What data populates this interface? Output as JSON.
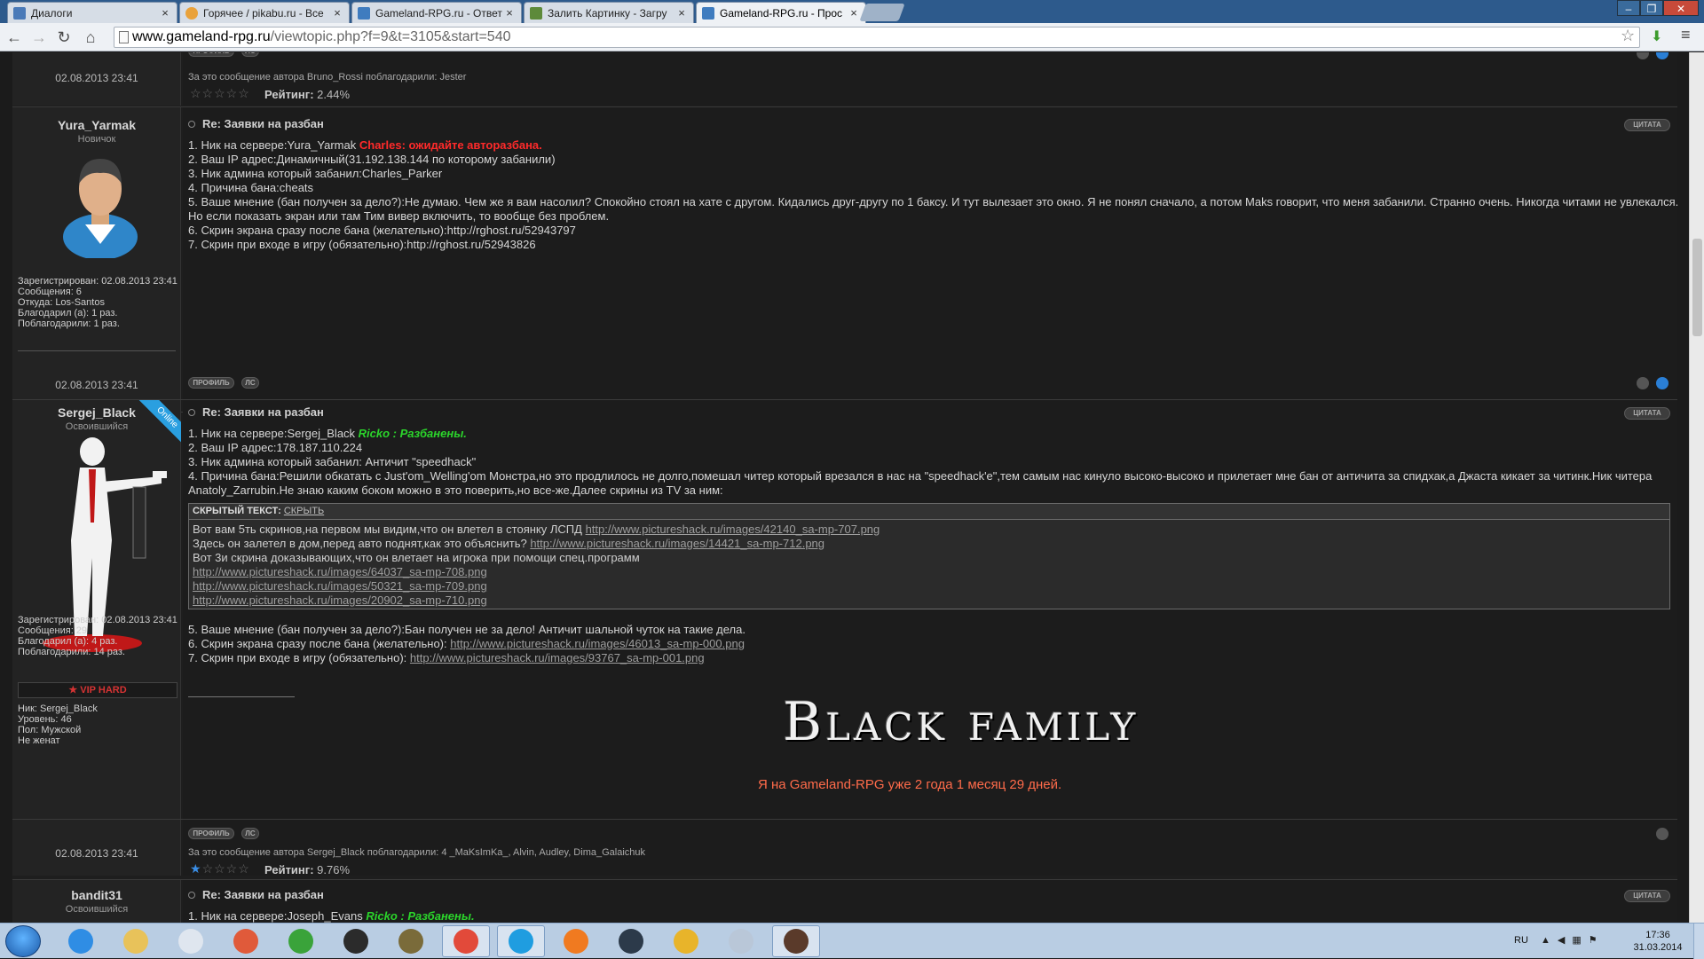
{
  "browser": {
    "tabs": [
      {
        "title": "Диалоги",
        "active": false,
        "color": "#4a7ab8"
      },
      {
        "title": "Горячее / pikabu.ru - Все",
        "active": false,
        "color": "#e9a23b"
      },
      {
        "title": "Gameland-RPG.ru - Ответ",
        "active": false,
        "color": "#3f7cbf"
      },
      {
        "title": "Залить Картинку - Загру",
        "active": false,
        "color": "#5d8a3a"
      },
      {
        "title": "Gameland-RPG.ru - Прос",
        "active": true,
        "color": "#3f7cbf"
      }
    ],
    "url_domain": "www.gameland-rpg.ru",
    "url_path": "/viewtopic.php?f=9&t=3105&start=540",
    "tab_close": "×"
  },
  "forum": {
    "profile_label": "ПРОФИЛЬ",
    "pm_label": "ЛС",
    "quote_label": "ЦИТАТА",
    "top_block": {
      "date": "02.08.2013 23:41",
      "thanks": "За это сообщение автора Bruno_Rossi поблагодарили: Jester",
      "rating_label": "Рейтинг:",
      "rating_value": "2.44%"
    },
    "post1": {
      "username": "Yura_Yarmak",
      "rank": "Новичок",
      "reg": "Зарегистрирован: 02.08.2013 23:41",
      "messages": "Сообщения: 6",
      "from": "Откуда: Los-Santos",
      "thanked": "Благодарил (а): 1 раз.",
      "was_thanked": "Поблагодарили: 1 раз.",
      "title": "Re: Заявки на разбан",
      "line1_pre": "1. Ник на сервере:Yura_Yarmak",
      "line1_red": "Charles: ожидайте авторазбана.",
      "line2": "2. Ваш IP адрес:Динамичный(31.192.138.144 по которому забанили)",
      "line3": "3. Ник админа который забанил:Charles_Parker",
      "line4": "4. Причина бана:cheats",
      "line5": "5. Ваше мнение (бан получен за дело?):Не думаю. Чем же я вам насолил? Спокойно стоял на хате с другом. Кидались друг-другу по 1 баксу. И тут вылезает это окно. Я не понял сначало, а потом Maks говорит, что меня забанили. Странно очень. Никогда читами не увлекался. Но если показать экран или там Тим вивер включить, то вообще без проблем.",
      "line6": "6. Скрин экрана сразу после бана (желательно):http://rghost.ru/52943797",
      "line7": "7. Скрин при входе в игру (обязательно):http://rghost.ru/52943826",
      "date": "02.08.2013 23:41"
    },
    "post2": {
      "username": "Sergej_Black",
      "rank": "Освоившийся",
      "online": "Online",
      "reg": "Зарегистрирован: 02.08.2013 23:41",
      "messages": "Сообщения: 29",
      "thanked": "Благодарил (а): 4 раз.",
      "was_thanked": "Поблагодарили: 14 раз.",
      "vip": "VIP HARD",
      "nick": "Ник: Sergej_Black",
      "level": "Уровень: 46",
      "sex": "Пол: Мужской",
      "married": "Не женат",
      "title": "Re: Заявки на разбан",
      "line1_pre": "1. Ник на сервере:Sergej_Black",
      "line1_grn": "Ricko : Разбанены.",
      "line2": "2. Ваш IP адрес:178.187.110.224",
      "line3": "3. Ник админа который забанил: Античит \"speedhack\"",
      "line4": "4. Причина бана:Решили обкатать с Just'om_Welling'om Монстра,но это продлилось не долго,помешал читер который врезался в нас на \"speedhack'e\",тем самым нас кинуло высоко-высоко и прилетает мне бан от античита за спидхак,а Джаста кикает за читинк.Ник читера Anatoly_Zarrubin.Не знаю каким боком можно в это поверить,но все-же.Далее скрины из TV за ним:",
      "spoiler_label": "СКРЫТЫЙ ТЕКСТ:",
      "spoiler_toggle": "СКРЫТЬ",
      "sp1_text": "Вот вам 5ть скринов,на первом мы видим,что он влетел в стоянку ЛСПД",
      "sp1_link": "http://www.pictureshack.ru/images/42140_sa-mp-707.png",
      "sp2_text": "Здесь он залетел в дом,перед авто поднят,как это объяснить?",
      "sp2_link": "http://www.pictureshack.ru/images/14421_sa-mp-712.png",
      "sp3_text": "Вот 3и скрина доказывающих,что он влетает на игрока при помощи спец.программ",
      "sp4_link": "http://www.pictureshack.ru/images/64037_sa-mp-708.png",
      "sp5_link": "http://www.pictureshack.ru/images/50321_sa-mp-709.png",
      "sp6_link": "http://www.pictureshack.ru/images/20902_sa-mp-710.png",
      "line5": "5. Ваше мнение (бан получен за дело?):Бан получен не за дело! Античит шальной чуток на такие дела.",
      "line6_text": "6. Скрин экрана сразу после бана (желательно):",
      "line6_link": "http://www.pictureshack.ru/images/46013_sa-mp-000.png",
      "line7_text": "7. Скрин при входе в игру (обязательно):",
      "line7_link": "http://www.pictureshack.ru/images/93767_sa-mp-001.png",
      "sig_title": "Black family",
      "sig_sub": "Я на Gameland-RPG уже 2 года 1 месяц 29 дней.",
      "date": "02.08.2013 23:41",
      "thanks": "За это сообщение автора Sergej_Black поблагодарили: 4 _MaKsImKa_, Alvin, Audley, Dima_Galaichuk",
      "rating_label": "Рейтинг:",
      "rating_value": "9.76%",
      "rating_fraction": 0.0976
    },
    "post3": {
      "username": "bandit31",
      "rank": "Освоившийся",
      "title": "Re: Заявки на разбан",
      "line1_pre": "1. Ник на сервере:Joseph_Evans",
      "line1_grn": "Ricko : Разбанены."
    }
  },
  "taskbar": {
    "lang": "RU",
    "time": "17:36",
    "date": "31.03.2014",
    "apps": [
      {
        "name": "ie-icon",
        "color": "#2f8de4",
        "active": false
      },
      {
        "name": "explorer-icon",
        "color": "#e8c25a",
        "active": false
      },
      {
        "name": "notepad-icon",
        "color": "#dfe6ef",
        "active": false
      },
      {
        "name": "paint-icon",
        "color": "#e05a3a",
        "active": false
      },
      {
        "name": "utorrent-icon",
        "color": "#3aa33a",
        "active": false
      },
      {
        "name": "clock-app-icon",
        "color": "#2b2b2b",
        "active": false
      },
      {
        "name": "onion-icon",
        "color": "#7a6b3a",
        "active": false
      },
      {
        "name": "chrome-icon",
        "color": "#e24a3a",
        "active": true
      },
      {
        "name": "skype-icon",
        "color": "#1f9de0",
        "active": true
      },
      {
        "name": "origin-icon",
        "color": "#f07a20",
        "active": false
      },
      {
        "name": "steam-icon",
        "color": "#2c3a4a",
        "active": false
      },
      {
        "name": "pizza-icon",
        "color": "#e8b42a",
        "active": false
      },
      {
        "name": "mail-icon",
        "color": "#b9c7d8",
        "active": false
      },
      {
        "name": "photo-viewer-icon",
        "color": "#5a3a2a",
        "active": true
      }
    ]
  }
}
